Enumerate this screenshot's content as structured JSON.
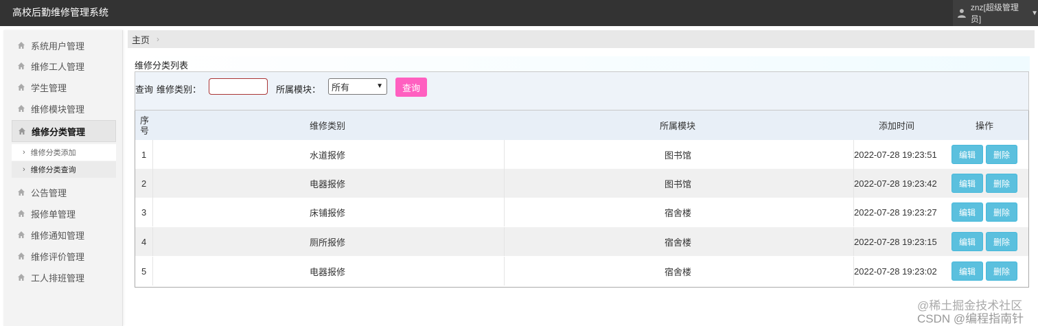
{
  "app": {
    "title": "高校后勤维修管理系统",
    "user": "znz[超级管理员]"
  },
  "sidebar": {
    "items": [
      {
        "label": "系统用户管理"
      },
      {
        "label": "维修工人管理"
      },
      {
        "label": "学生管理"
      },
      {
        "label": "维修模块管理"
      },
      {
        "label": "维修分类管理",
        "active": true
      },
      {
        "label": "公告管理"
      },
      {
        "label": "报修单管理"
      },
      {
        "label": "维修通知管理"
      },
      {
        "label": "维修评价管理"
      },
      {
        "label": "工人排班管理"
      }
    ],
    "subitems": [
      {
        "label": "维修分类添加"
      },
      {
        "label": "维修分类查询",
        "active": true
      }
    ]
  },
  "breadcrumb": {
    "home": "主页"
  },
  "panel": {
    "title": "维修分类列表"
  },
  "search": {
    "query_label": "查询",
    "category_label": "维修类别：",
    "category_value": "",
    "module_label": "所属模块：",
    "module_selected": "所有",
    "button": "查询"
  },
  "table": {
    "headers": {
      "seq_line1": "序",
      "seq_line2": "号",
      "category": "维修类别",
      "module": "所属模块",
      "time": "添加时间",
      "action": "操作"
    },
    "edit_label": "编辑",
    "delete_label": "删除",
    "rows": [
      {
        "seq": "1",
        "category": "水道报修",
        "module": "图书馆",
        "time": "2022-07-28 19:23:51"
      },
      {
        "seq": "2",
        "category": "电器报修",
        "module": "图书馆",
        "time": "2022-07-28 19:23:42"
      },
      {
        "seq": "3",
        "category": "床铺报修",
        "module": "宿舍楼",
        "time": "2022-07-28 19:23:27"
      },
      {
        "seq": "4",
        "category": "厕所报修",
        "module": "宿舍楼",
        "time": "2022-07-28 19:23:15"
      },
      {
        "seq": "5",
        "category": "电器报修",
        "module": "宿舍楼",
        "time": "2022-07-28 19:23:02"
      }
    ]
  },
  "watermark": {
    "line1": "@稀土掘金技术社区",
    "line2": "CSDN @编程指南针"
  }
}
